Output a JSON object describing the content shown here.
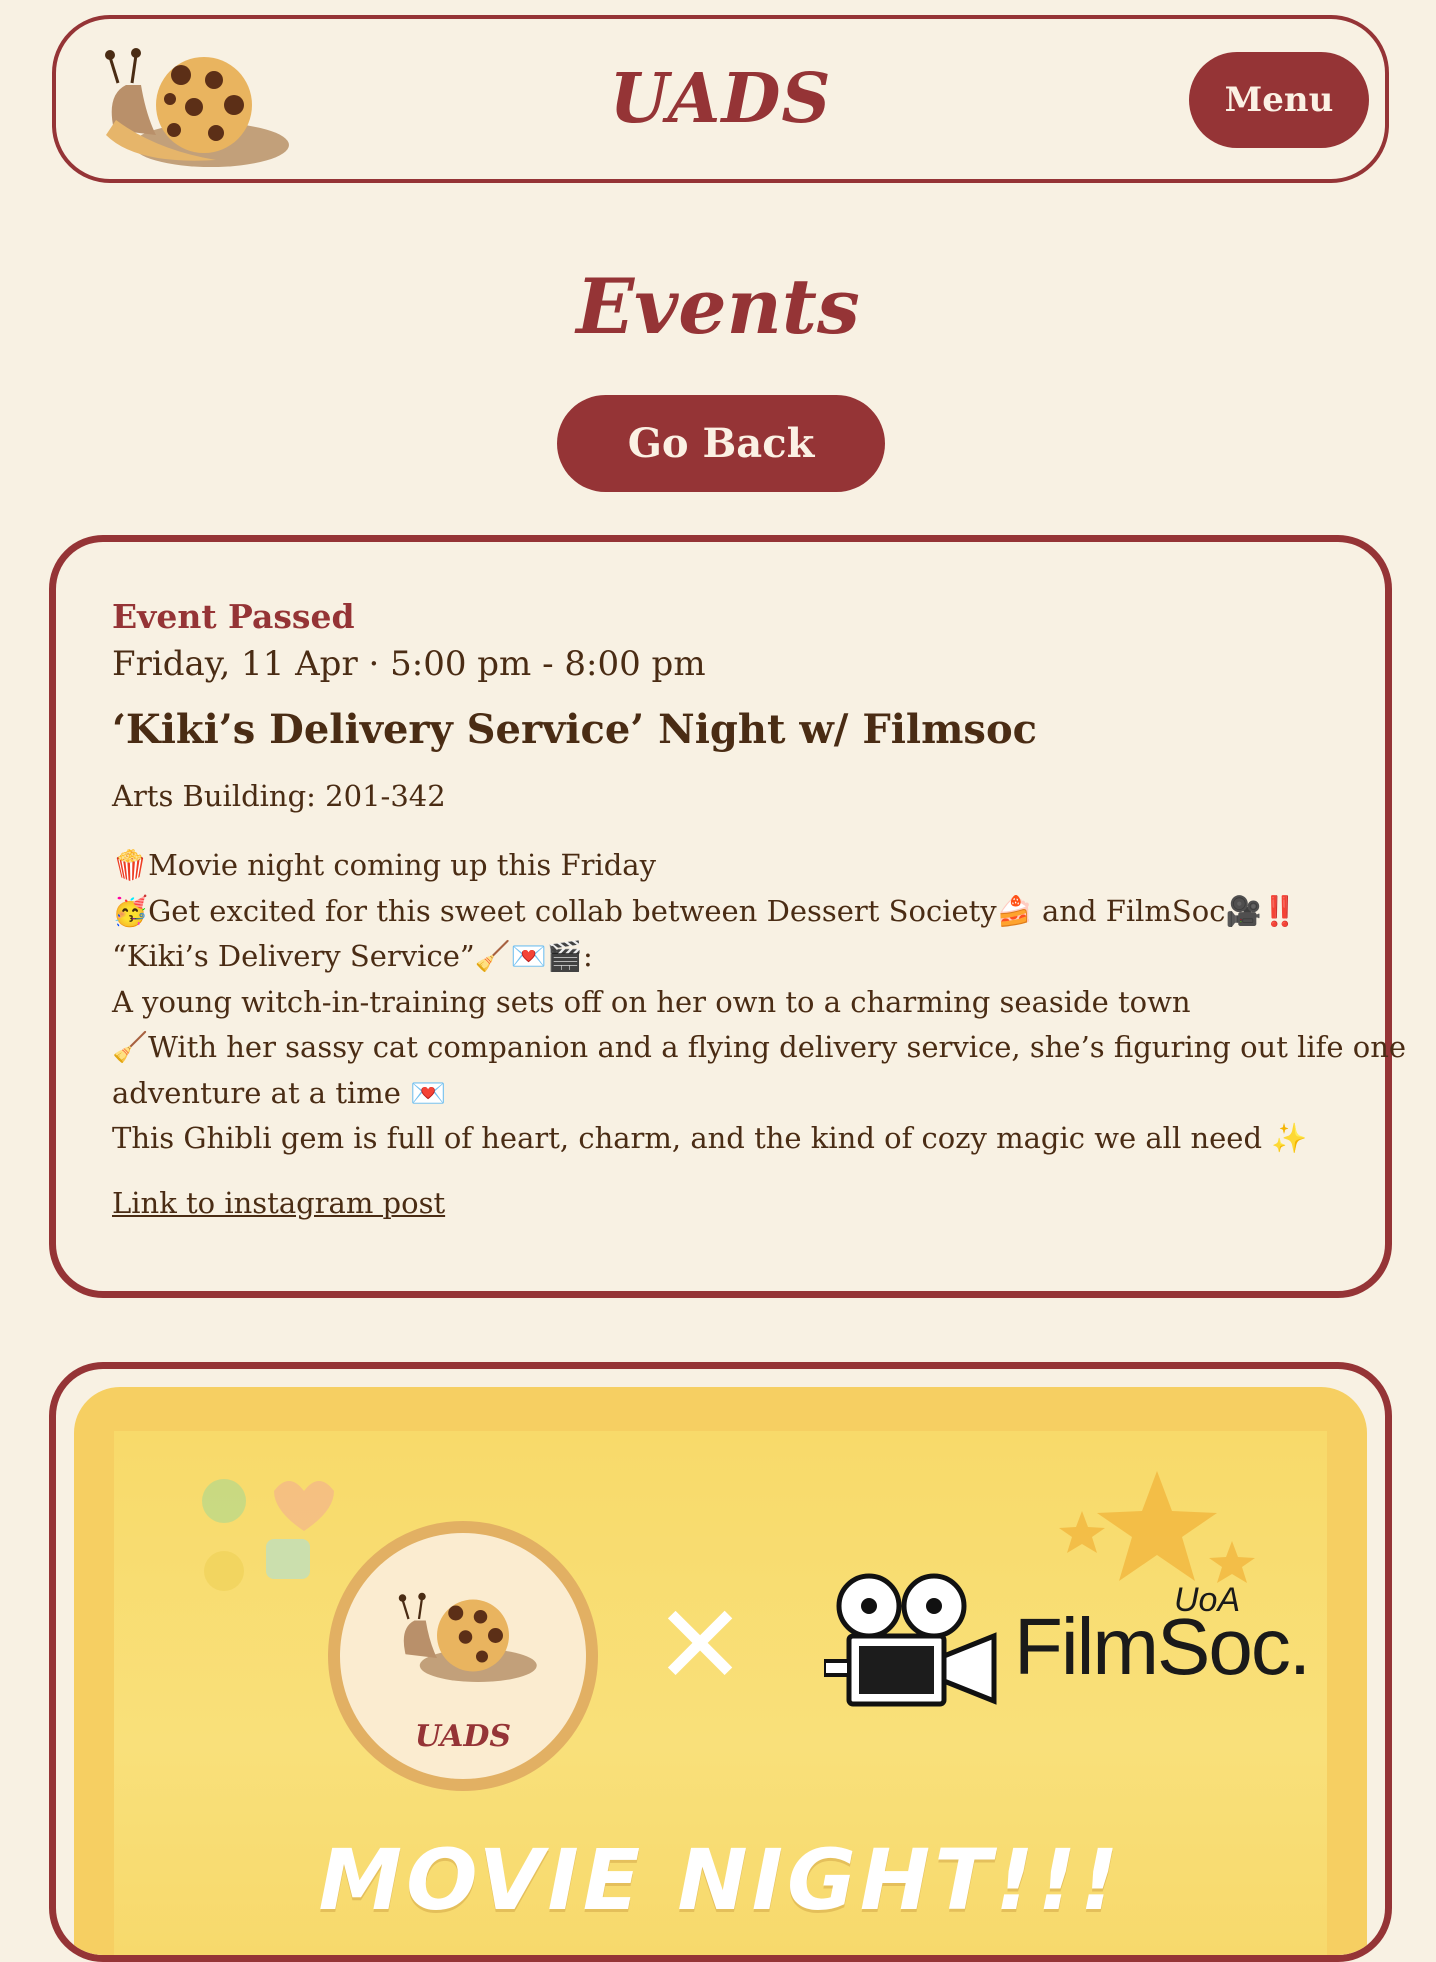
{
  "header": {
    "brand": "UADS",
    "menu_label": "Menu"
  },
  "page": {
    "title": "Events",
    "back_label": "Go Back"
  },
  "event": {
    "status": "Event Passed",
    "datetime": "Friday, 11 Apr · 5:00 pm - 8:00 pm",
    "title": "‘Kiki’s Delivery Service’ Night w/ Filmsoc",
    "location": "Arts Building: 201-342",
    "description": [
      "🍿Movie night coming up this Friday",
      "🥳Get excited for this sweet collab between Dessert Society🍰 and FilmSoc🎥‼️",
      "“Kiki’s Delivery Service”🧹💌🎬:",
      "A young witch-in-training sets off on her own to a charming seaside town",
      "🧹With her sassy cat companion and a flying delivery service, she’s figuring out life one",
      "adventure at a time 💌",
      "This Ghibli gem is full of heart, charm, and the kind of cozy magic we all need ✨"
    ],
    "link_label": "Link to instagram post"
  },
  "poster": {
    "badge_text": "UADS",
    "cross": "✕",
    "filmsoc": "FilmSoc.",
    "uoa": "UoA",
    "headline": "MOVIE NIGHT!!!"
  },
  "colors": {
    "accent": "#953436",
    "background": "#f8f1e3",
    "text": "#4a2c14"
  }
}
